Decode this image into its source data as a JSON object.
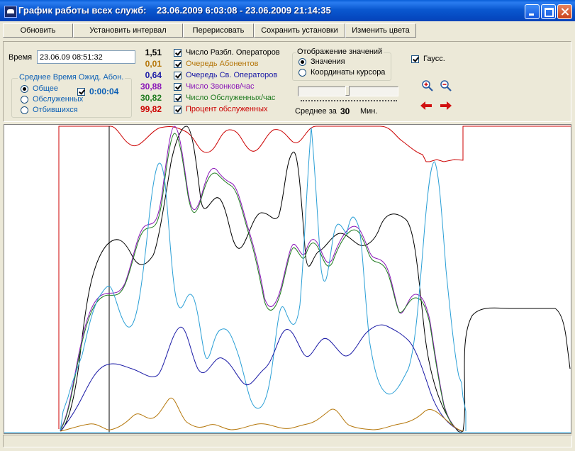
{
  "window": {
    "title": "График работы всех служб:    23.06.2009 6:03:08 - 23.06.2009 21:14:35"
  },
  "toolbar": {
    "buttons": [
      "Обновить",
      "Установить интервал",
      "Перерисовать",
      "Сохранить установки",
      "Изменить цвета"
    ]
  },
  "time": {
    "label": "Время",
    "value": "23.06.09 08:51:32"
  },
  "avg_wait": {
    "title": "Среднее Время Ожид. Абон.",
    "options": [
      "Общее",
      "Обслуженных",
      "Отбившихся"
    ],
    "selected": "Общее",
    "value": "0:00:04",
    "checked": true
  },
  "series": [
    {
      "value": "1,51",
      "label": "Число Разбл. Операторов",
      "color": "#000000",
      "checked": true
    },
    {
      "value": "0,01",
      "label": "Очередь Абонентов",
      "color": "#b5770b",
      "checked": true
    },
    {
      "value": "0,64",
      "label": "Очередь Св. Операторов",
      "color": "#1a1aa6",
      "checked": true
    },
    {
      "value": "30,88",
      "label": "Число Звонков/час",
      "color": "#8a16b8",
      "checked": true
    },
    {
      "value": "30,82",
      "label": "Число Обслуженных/час",
      "color": "#1f7a1f",
      "checked": true
    },
    {
      "value": "99,82",
      "label": "Процент обслуженных",
      "color": "#cc0000",
      "checked": true
    }
  ],
  "display": {
    "title": "Отображение значений",
    "options": [
      "Значения",
      "Координаты курсора"
    ],
    "selected": "Значения"
  },
  "average": {
    "label": "Среднее за",
    "value": "30",
    "unit": "Мин."
  },
  "gauss": {
    "label": "Гаусс.",
    "checked": true
  },
  "icons": {
    "zoom_in": "zoom-in-icon",
    "zoom_out": "zoom-out-icon",
    "arrow_left": "arrow-left-icon",
    "arrow_right": "arrow-right-icon"
  },
  "colors": {
    "title_bar": "#0a58d0",
    "cyan_series": "#2a9fd6"
  }
}
